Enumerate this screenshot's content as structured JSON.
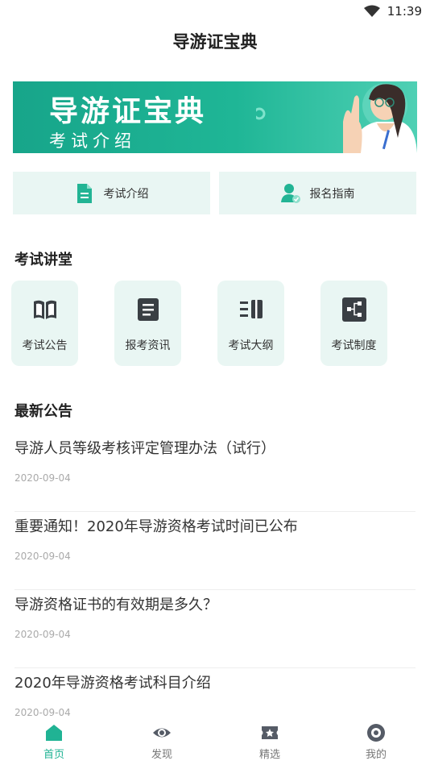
{
  "status_bar": {
    "time": "11:39"
  },
  "app": {
    "title": "导游证宝典"
  },
  "banner": {
    "title": "导游证宝典",
    "subtitle": "考试介绍"
  },
  "quick_actions": [
    {
      "label": "考试介绍",
      "icon": "document-icon"
    },
    {
      "label": "报名指南",
      "icon": "user-check-icon"
    }
  ],
  "lecture_section": {
    "title": "考试讲堂",
    "items": [
      {
        "label": "考试公告",
        "icon": "book-icon"
      },
      {
        "label": "报考资讯",
        "icon": "news-icon"
      },
      {
        "label": "考试大纲",
        "icon": "outline-icon"
      },
      {
        "label": "考试制度",
        "icon": "flowchart-icon"
      }
    ]
  },
  "news_section": {
    "title": "最新公告",
    "items": [
      {
        "title": "导游人员等级考核评定管理办法（试行）",
        "date": "2020-09-04"
      },
      {
        "title": "重要通知！2020年导游资格考试时间已公布",
        "date": "2020-09-04"
      },
      {
        "title": "导游资格证书的有效期是多久？",
        "date": "2020-09-04"
      },
      {
        "title": "2020年导游资格考试科目介绍",
        "date": "2020-09-04"
      }
    ]
  },
  "tab_bar": {
    "active": "首页",
    "items": [
      {
        "label": "首页",
        "icon": "home-icon"
      },
      {
        "label": "发现",
        "icon": "eye-icon"
      },
      {
        "label": "精选",
        "icon": "star-ticket-icon"
      },
      {
        "label": "我的",
        "icon": "profile-icon"
      }
    ]
  },
  "colors": {
    "accent": "#20b394",
    "tile_bg": "#e9f6f3",
    "icon_dark": "#3a3f44"
  }
}
